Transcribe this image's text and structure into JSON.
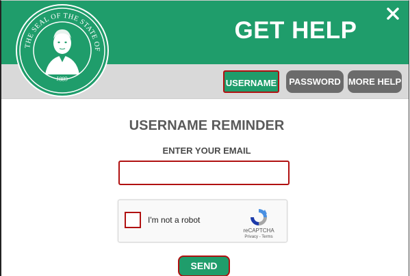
{
  "header": {
    "title": "GET HELP",
    "close_icon": "close-icon",
    "seal": {
      "text_top": "THE SEAL OF THE STATE OF WASHINGTON",
      "year": "1889",
      "icon": "state-seal-logo"
    }
  },
  "tabs": [
    {
      "label": "USERNAME",
      "active": true
    },
    {
      "label": "PASSWORD",
      "active": false
    },
    {
      "label": "MORE HELP",
      "active": false
    }
  ],
  "form": {
    "heading": "USERNAME REMINDER",
    "email_label": "ENTER YOUR EMAIL",
    "email_value": "",
    "email_placeholder": "",
    "recaptcha": {
      "label": "I'm not a robot",
      "brand": "reCAPTCHA",
      "links": "Privacy - Terms"
    },
    "send_label": "SEND"
  },
  "colors": {
    "brand_green": "#1f9d6b",
    "tab_grey": "#6b6b6b",
    "highlight_red": "#b01010",
    "header_grey_band": "#d9d9d9"
  }
}
